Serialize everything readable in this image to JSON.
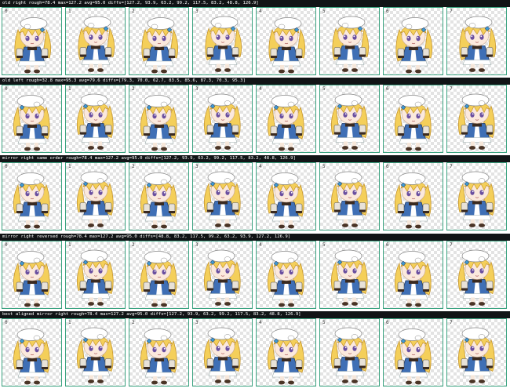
{
  "sections": [
    {
      "label": "old right rough=78.4 max=127.2 avg=95.0 diffs=[127.2, 93.9, 63.2, 99.2, 117.5, 83.2, 48.8, 126.9]",
      "frames": [
        "0",
        "1",
        "2",
        "3",
        "4",
        "5",
        "6",
        "7"
      ],
      "facing": "right"
    },
    {
      "label": "old left rough=32.8 max=95.3 avg=79.6 diffs=[79.3, 70.0, 62.7, 83.5, 85.6, 87.3, 70.3, 95.3]",
      "frames": [
        "0",
        "1",
        "2",
        "3",
        "4",
        "5",
        "6",
        "7"
      ],
      "facing": "left"
    },
    {
      "label": "mirror right same order rough=78.4 max=127.2 avg=95.0 diffs=[127.2, 93.9, 63.2, 99.2, 117.5, 83.2, 48.8, 126.9]",
      "frames": [
        "0",
        "1",
        "2",
        "3",
        "4",
        "5",
        "6",
        "7"
      ],
      "facing": "left"
    },
    {
      "label": "mirror right reversed rough=78.4 max=127.2 avg=95.0 diffs=[48.8, 83.2, 117.5, 99.2, 63.2, 93.9, 127.2, 126.9]",
      "frames": [
        "0",
        "1",
        "2",
        "3",
        "4",
        "5",
        "6",
        "7"
      ],
      "facing": "left"
    },
    {
      "label": "best aligned mirror right rough=78.4 max=127.2 avg=95.0 diffs=[127.2, 93.9, 63.2, 99.2, 117.5, 83.2, 48.8, 126.9]",
      "frames": [
        "0",
        "1",
        "2",
        "3",
        "4",
        "5",
        "6",
        "7"
      ],
      "facing": "left"
    }
  ],
  "colors": {
    "header_bg": "#111416",
    "frame_border": "#3aa380",
    "hair": "#f4cf5a",
    "coat": "#3f6fb5",
    "hat": "#ffffff"
  },
  "icons": {
    "sprite": "chibi-girl-sprite-icon"
  }
}
